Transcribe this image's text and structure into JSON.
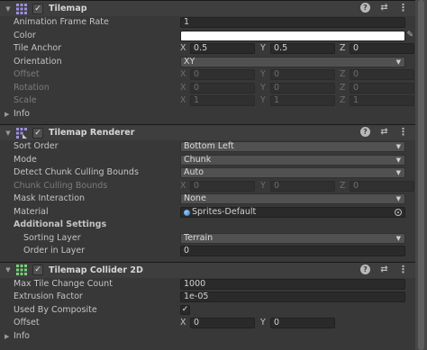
{
  "tilemap": {
    "title": "Tilemap",
    "icon": "tilemap-grid-icon",
    "enabled": true,
    "animation_frame_rate": {
      "label": "Animation Frame Rate",
      "value": "1"
    },
    "color": {
      "label": "Color",
      "value": "#ffffff"
    },
    "tile_anchor": {
      "label": "Tile Anchor",
      "x": "0.5",
      "y": "0.5",
      "z": "0"
    },
    "orientation": {
      "label": "Orientation",
      "value": "XY"
    },
    "offset": {
      "label": "Offset",
      "x": "0",
      "y": "0",
      "z": "0"
    },
    "rotation": {
      "label": "Rotation",
      "x": "0",
      "y": "0",
      "z": "0"
    },
    "scale": {
      "label": "Scale",
      "x": "1",
      "y": "1",
      "z": "1"
    },
    "info": {
      "label": "Info"
    }
  },
  "renderer": {
    "title": "Tilemap Renderer",
    "icon": "tilemap-renderer-icon",
    "enabled": true,
    "sort_order": {
      "label": "Sort Order",
      "value": "Bottom Left"
    },
    "mode": {
      "label": "Mode",
      "value": "Chunk"
    },
    "detect_bounds": {
      "label": "Detect Chunk Culling Bounds",
      "value": "Auto"
    },
    "chunk_bounds": {
      "label": "Chunk Culling Bounds",
      "x": "0",
      "y": "0",
      "z": "0"
    },
    "mask_interaction": {
      "label": "Mask Interaction",
      "value": "None"
    },
    "material": {
      "label": "Material",
      "value": "Sprites-Default"
    },
    "additional_settings": {
      "label": "Additional Settings"
    },
    "sorting_layer": {
      "label": "Sorting Layer",
      "value": "Terrain"
    },
    "order_in_layer": {
      "label": "Order in Layer",
      "value": "0"
    }
  },
  "collider": {
    "title": "Tilemap Collider 2D",
    "icon": "tilemap-collider-icon",
    "enabled": true,
    "max_tile_change": {
      "label": "Max Tile Change Count",
      "value": "1000"
    },
    "extrusion": {
      "label": "Extrusion Factor",
      "value": "1e-05"
    },
    "used_by_composite": {
      "label": "Used By Composite",
      "checked": true
    },
    "offset": {
      "label": "Offset",
      "x": "0",
      "y": "0"
    },
    "info": {
      "label": "Info"
    }
  },
  "axes": {
    "x": "X",
    "y": "Y",
    "z": "Z"
  },
  "header_buttons": {
    "help": "?",
    "preset": "⇄",
    "menu": "⋮"
  },
  "glyphs": {
    "check": "✓",
    "collapse": "▼",
    "expand": "▶",
    "dropdown": "▼",
    "eyedropper": "✎"
  }
}
